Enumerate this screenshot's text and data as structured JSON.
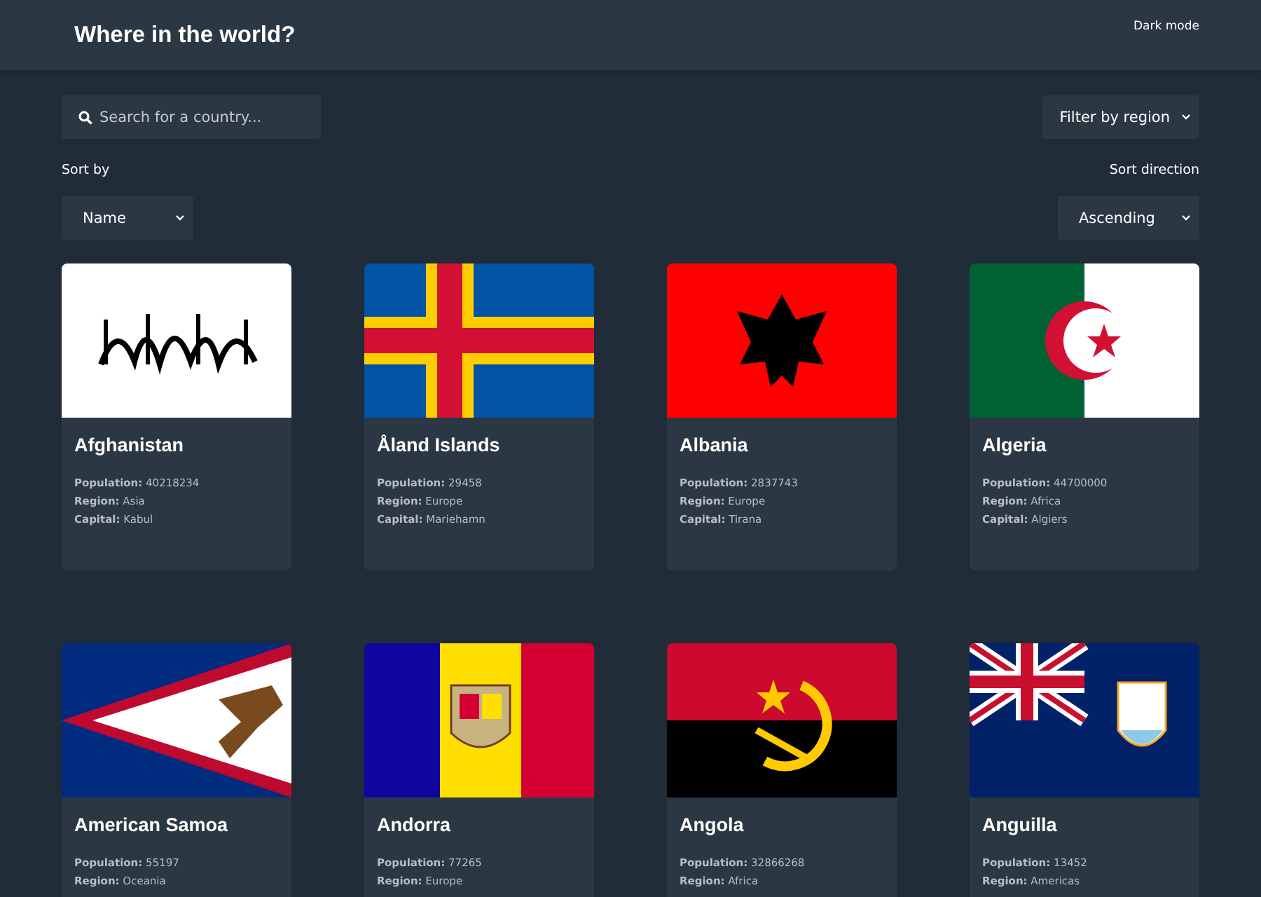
{
  "header": {
    "title": "Where in the world?",
    "theme_toggle": "Dark mode"
  },
  "search": {
    "placeholder": "Search for a country..."
  },
  "region_filter": {
    "value": "Filter by region"
  },
  "sort_by": {
    "label": "Sort by",
    "value": "Name"
  },
  "sort_direction": {
    "label": "Sort direction",
    "value": "Ascending"
  },
  "countries": [
    {
      "name": "Afghanistan",
      "kind": "afghanistan",
      "details": [
        "**Population:** 40218234",
        "**Region:** Asia",
        "**Capital:** Kabul"
      ]
    },
    {
      "name": "Åland Islands",
      "kind": "aland",
      "details": [
        "**Population:** 29458",
        "**Region:** Europe",
        "**Capital:** Mariehamn"
      ]
    },
    {
      "name": "Albania",
      "kind": "albania",
      "details": [
        "**Population:** 2837743",
        "**Region:** Europe",
        "**Capital:** Tirana"
      ]
    },
    {
      "name": "Algeria",
      "kind": "algeria",
      "details": [
        "**Population:** 44700000",
        "**Region:** Africa",
        "**Capital:** Algiers"
      ]
    },
    {
      "name": "American Samoa",
      "kind": "samoa",
      "details": [
        "**Population:** 55197",
        "**Region:** Oceania"
      ]
    },
    {
      "name": "Andorra",
      "kind": "andorra",
      "details": [
        "**Population:** 77265",
        "**Region:** Europe"
      ]
    },
    {
      "name": "Angola",
      "kind": "angola",
      "details": [
        "**Population:** 32866268",
        "**Region:** Africa"
      ]
    },
    {
      "name": "Anguilla",
      "kind": "anguilla",
      "details": [
        "**Population:** 13452",
        "**Region:** Americas"
      ]
    }
  ]
}
